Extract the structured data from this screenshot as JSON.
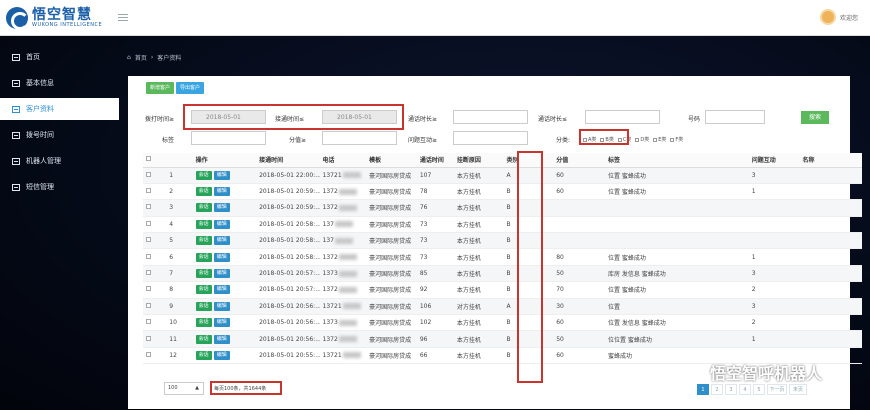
{
  "header": {
    "logo_text": "悟空智慧",
    "logo_subtitle": "WUKONG INTELLIGENCE",
    "user_name": "欢迎您"
  },
  "sidebar": {
    "items": [
      {
        "label": "首页",
        "active": false
      },
      {
        "label": "基本信息",
        "active": false
      },
      {
        "label": "客户资料",
        "active": true
      },
      {
        "label": "拨号时间",
        "active": false
      },
      {
        "label": "机器人管理",
        "active": false
      },
      {
        "label": "短信管理",
        "active": false
      }
    ]
  },
  "breadcrumb": {
    "home": "首页",
    "current": "客户资料"
  },
  "toolbar": {
    "add_label": "新增客户",
    "export_label": "导出客户"
  },
  "filters": {
    "dial_time_label": "拨打时间≥",
    "dial_time_value": "2018-05-01",
    "connect_time_label": "接通时间≤",
    "connect_time_value": "2018-05-01",
    "call_duration_label": "通话时长≥",
    "hangup_duration_label": "通话时长≤",
    "phone_label": "号码",
    "tag_label": "标签",
    "score_label": "分值≥",
    "interaction_label": "问题互动≥",
    "category_label": "分类:",
    "categories": [
      "A类",
      "B类",
      "C类",
      "D类",
      "E类",
      "F类"
    ],
    "search_label": "搜索"
  },
  "table": {
    "headers": [
      "",
      "",
      "操作",
      "接通时间",
      "电话",
      "模板",
      "通话时间",
      "挂断原因",
      "类别",
      "分值",
      "标签",
      "问题互动",
      "名称"
    ],
    "action_labels": {
      "detail": "会话",
      "edit": "编辑"
    },
    "rows": [
      {
        "n": "1",
        "time": "2018-05-01 22:00:...",
        "phone": "13721",
        "template": "豪河国际房贷成",
        "duration": "107",
        "reason": "本方挂机",
        "cat": "A",
        "score": "60",
        "tags": "位置 蜜蜂成功",
        "inter": "3"
      },
      {
        "n": "2",
        "time": "2018-05-01 20:59:...",
        "phone": "1372",
        "template": "豪河国际房贷成",
        "duration": "78",
        "reason": "本方挂机",
        "cat": "B",
        "score": "60",
        "tags": "位置 蜜蜂成功",
        "inter": "1"
      },
      {
        "n": "3",
        "time": "2018-05-01 20:59:...",
        "phone": "1372",
        "template": "豪河国际房贷成",
        "duration": "76",
        "reason": "本方挂机",
        "cat": "B",
        "score": "",
        "tags": "",
        "inter": ""
      },
      {
        "n": "4",
        "time": "2018-05-01 20:58:...",
        "phone": "137",
        "template": "豪河国际房贷成",
        "duration": "73",
        "reason": "本方挂机",
        "cat": "B",
        "score": "",
        "tags": "",
        "inter": ""
      },
      {
        "n": "5",
        "time": "2018-05-01 20:58:...",
        "phone": "137",
        "template": "豪河国际房贷成",
        "duration": "73",
        "reason": "本方挂机",
        "cat": "B",
        "score": "",
        "tags": "",
        "inter": ""
      },
      {
        "n": "6",
        "time": "2018-05-01 20:58:...",
        "phone": "1372",
        "template": "豪河国际房贷成",
        "duration": "73",
        "reason": "本方挂机",
        "cat": "B",
        "score": "80",
        "tags": "位置 蜜蜂成功",
        "inter": "1"
      },
      {
        "n": "7",
        "time": "2018-05-01 20:57:...",
        "phone": "1373",
        "template": "豪河国际房贷成",
        "duration": "85",
        "reason": "本方挂机",
        "cat": "B",
        "score": "50",
        "tags": "库房 发信息 蜜蜂成功",
        "inter": "3"
      },
      {
        "n": "8",
        "time": "2018-05-01 20:57:...",
        "phone": "1372",
        "template": "豪河国际房贷成",
        "duration": "92",
        "reason": "本方挂机",
        "cat": "B",
        "score": "70",
        "tags": "位置 蜜蜂成功",
        "inter": "2"
      },
      {
        "n": "9",
        "time": "2018-05-01 20:56:...",
        "phone": "13721",
        "template": "豪河国际房贷成",
        "duration": "106",
        "reason": "对方挂机",
        "cat": "A",
        "score": "30",
        "tags": "位置",
        "inter": "3"
      },
      {
        "n": "10",
        "time": "2018-05-01 20:56:...",
        "phone": "1373",
        "template": "豪河国际房贷成",
        "duration": "102",
        "reason": "本方挂机",
        "cat": "B",
        "score": "60",
        "tags": "位置 发信息 蜜蜂成功",
        "inter": "2"
      },
      {
        "n": "11",
        "time": "2018-05-01 20:56:...",
        "phone": "1372",
        "template": "豪河国际房贷成",
        "duration": "96",
        "reason": "本方挂机",
        "cat": "B",
        "score": "50",
        "tags": "位位置 蜜蜂成功",
        "inter": "1"
      },
      {
        "n": "12",
        "time": "2018-05-01 20:55:...",
        "phone": "13721",
        "template": "豪河国际房贷成",
        "duration": "66",
        "reason": "本方挂机",
        "cat": "B",
        "score": "60",
        "tags": "蜜蜂成功",
        "inter": ""
      }
    ]
  },
  "footer": {
    "page_size": "100",
    "summary": "每页100条，共1644条",
    "pages": [
      "1",
      "2",
      "3",
      "4",
      "5",
      "下一页",
      "末页"
    ]
  },
  "watermark": "悟空智呼机器人",
  "colors": {
    "accent": "#2f8fc9",
    "green": "#5bb85d",
    "highlight": "#c8352e"
  }
}
